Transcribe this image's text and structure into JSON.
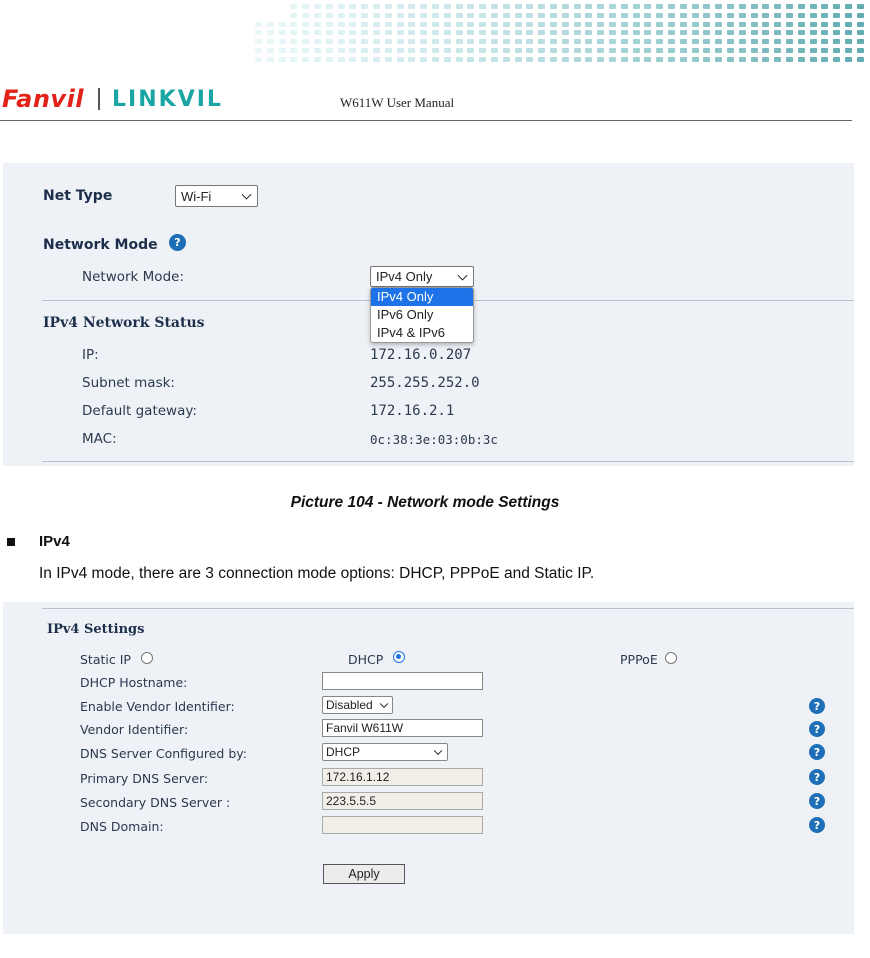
{
  "header": {
    "logo_brand": "Fanvil",
    "logo_sub": "LINKVIL",
    "doc_title": "W611W User Manual"
  },
  "network_panel": {
    "net_type_label": "Net Type",
    "net_type_value": "Wi-Fi",
    "network_mode_heading": "Network Mode",
    "network_mode_label": "Network Mode:",
    "network_mode_value": "IPv4 Only",
    "network_mode_options": [
      "IPv4 Only",
      "IPv6 Only",
      "IPv4 & IPv6"
    ],
    "status_heading": "IPv4 Network Status",
    "status": [
      {
        "label": "IP:",
        "value": "172.16.0.207"
      },
      {
        "label": "Subnet mask:",
        "value": "255.255.252.0"
      },
      {
        "label": "Default gateway:",
        "value": "172.16.2.1"
      },
      {
        "label": "MAC:",
        "value": "0c:38:3e:03:0b:3c"
      }
    ]
  },
  "caption": "Picture 104 - Network mode Settings",
  "section": {
    "heading": "IPv4",
    "paragraph": "In IPv4 mode, there are 3 connection mode options: DHCP, PPPoE and Static IP."
  },
  "ipv4_settings": {
    "title": "IPv4 Settings",
    "radios": [
      {
        "label": "Static IP",
        "checked": false
      },
      {
        "label": "DHCP",
        "checked": true
      },
      {
        "label": "PPPoE",
        "checked": false
      }
    ],
    "dhcp_hostname_label": "DHCP Hostname:",
    "dhcp_hostname_value": "",
    "vendor_id_enable_label": "Enable Vendor Identifier:",
    "vendor_id_enable_value": "Disabled",
    "vendor_id_label": "Vendor Identifier:",
    "vendor_id_value": "Fanvil W611W",
    "dns_config_label": "DNS Server Configured by:",
    "dns_config_value": "DHCP",
    "primary_dns_label": "Primary DNS Server:",
    "primary_dns_value": "172.16.1.12",
    "secondary_dns_label": "Secondary DNS Server :",
    "secondary_dns_value": "223.5.5.5",
    "dns_domain_label": "DNS Domain:",
    "dns_domain_value": "",
    "apply_label": "Apply"
  },
  "colors": {
    "brand_red": "#e2231a",
    "brand_teal": "#1aa5a5",
    "panel_bg": "#eef2f6",
    "selection_blue": "#1e73e8",
    "help_blue": "#1f6fb8"
  }
}
